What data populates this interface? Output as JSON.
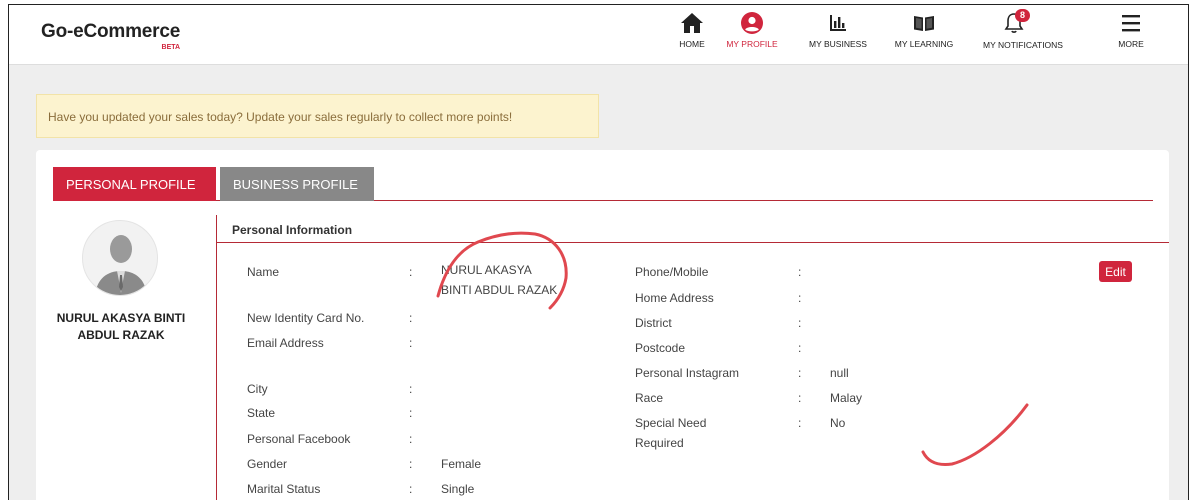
{
  "brand": {
    "name": "Go-eCommerce",
    "beta": "BETA"
  },
  "nav": [
    {
      "label": "HOME",
      "icon": "home-icon"
    },
    {
      "label": "MY PROFILE",
      "icon": "user-circle-icon",
      "active": true
    },
    {
      "label": "MY BUSINESS",
      "icon": "bar-chart-icon"
    },
    {
      "label": "MY LEARNING",
      "icon": "book-icon"
    },
    {
      "label": "MY NOTIFICATIONS",
      "icon": "bell-icon",
      "badge": "8"
    },
    {
      "label": "MORE",
      "icon": "hamburger-menu-icon"
    }
  ],
  "alert": {
    "text": "Have you updated your sales today? Update your sales regularly to collect more points!"
  },
  "tabs": {
    "personal": "PERSONAL PROFILE",
    "business": "BUSINESS PROFILE"
  },
  "profile": {
    "name_line1": "NURUL AKASYA BINTI",
    "name_line2": "ABDUL RAZAK"
  },
  "section": {
    "title": "Personal Information"
  },
  "left_fields": [
    {
      "label": "Name",
      "value_line1": "NURUL AKASYA",
      "value_line2": "BINTI ABDUL RAZAK"
    },
    {
      "label": "New Identity Card No.",
      "value": ""
    },
    {
      "label": "Email Address",
      "value": ""
    },
    {
      "label": "City",
      "value": ""
    },
    {
      "label": "State",
      "value": ""
    },
    {
      "label": "Personal Facebook",
      "value": ""
    },
    {
      "label": "Gender",
      "value": "Female"
    },
    {
      "label": "Marital Status",
      "value": "Single"
    }
  ],
  "right_fields": [
    {
      "label": "Phone/Mobile",
      "value": ""
    },
    {
      "label": "Home Address",
      "value": ""
    },
    {
      "label": "District",
      "value": ""
    },
    {
      "label": "Postcode",
      "value": ""
    },
    {
      "label": "Personal Instagram",
      "value": "null"
    },
    {
      "label": "Race",
      "value": "Malay"
    },
    {
      "label": "Special Need",
      "label_line2": "Required",
      "value": "No"
    }
  ],
  "separator": ":",
  "edit_label": "Edit",
  "colors": {
    "accent": "#d0253d",
    "tab_inactive": "#888888",
    "alert_bg": "#fcf3cf",
    "alert_text": "#8a6d3b",
    "annotation": "#e0484f"
  }
}
